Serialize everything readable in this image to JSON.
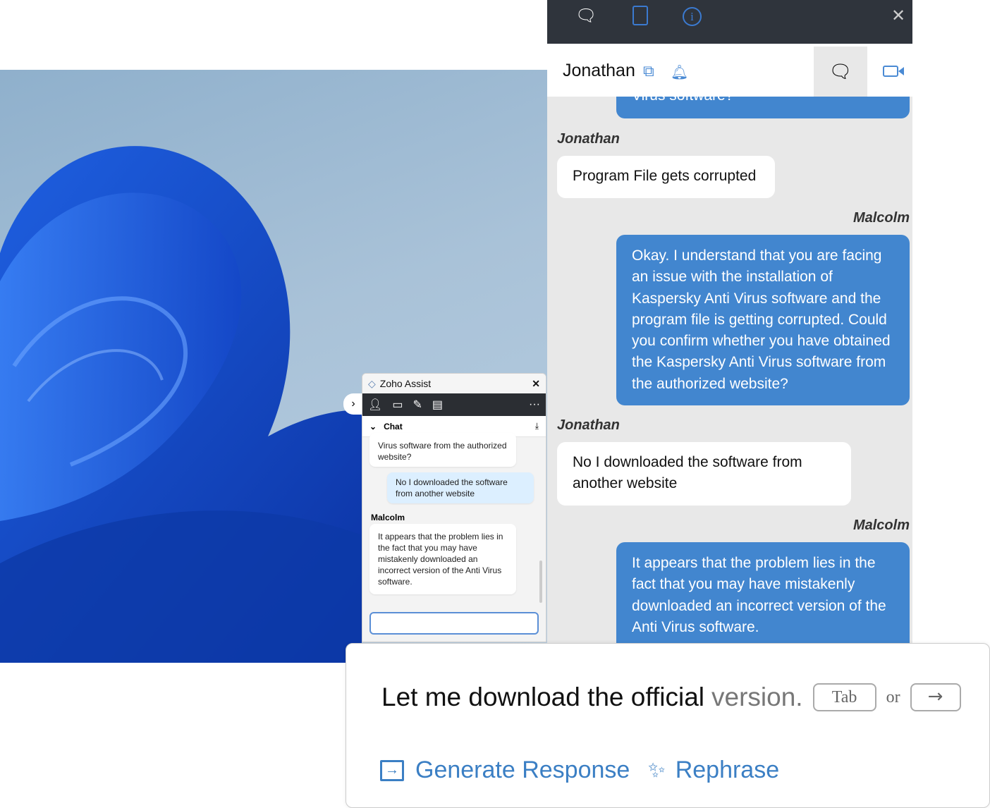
{
  "zoho": {
    "title": "Zoho Assist",
    "close": "✕",
    "more": "···",
    "chat_label": "Chat",
    "expand": "›",
    "messages": [
      {
        "text": "Virus software from the authorized website?"
      },
      {
        "text": "No I downloaded the software from another website"
      },
      {
        "sender": "Malcolm",
        "text": "It appears that the problem lies in the fact that you may have mistakenly downloaded an incorrect version of the Anti Virus software."
      }
    ],
    "input_value": ""
  },
  "panel": {
    "contact": "Jonathan",
    "messages": [
      {
        "text": "Virus software?"
      },
      {
        "sender": "Jonathan",
        "text": "Program File gets corrupted"
      },
      {
        "sender": "Malcolm",
        "text": "Okay. I understand that you are facing an issue with the installation of Kaspersky Anti Virus software and the program file is getting corrupted. Could you confirm whether you have obtained the Kaspersky Anti Virus software from the authorized website?"
      },
      {
        "sender": "Jonathan",
        "text": "No I downloaded the software from another website"
      },
      {
        "sender": "Malcolm",
        "text": "It appears that the problem lies in the fact that you may have mistakenly downloaded an incorrect version of the Anti Virus software."
      }
    ]
  },
  "suggestion": {
    "typed": "Let me download the official",
    "completion": " version.",
    "tab_key": "Tab",
    "or": "or",
    "arrow_key": "→",
    "generate": "Generate Response",
    "rephrase": "Rephrase"
  },
  "colors": {
    "accent": "#4286cf",
    "topbar": "#2f343c"
  }
}
